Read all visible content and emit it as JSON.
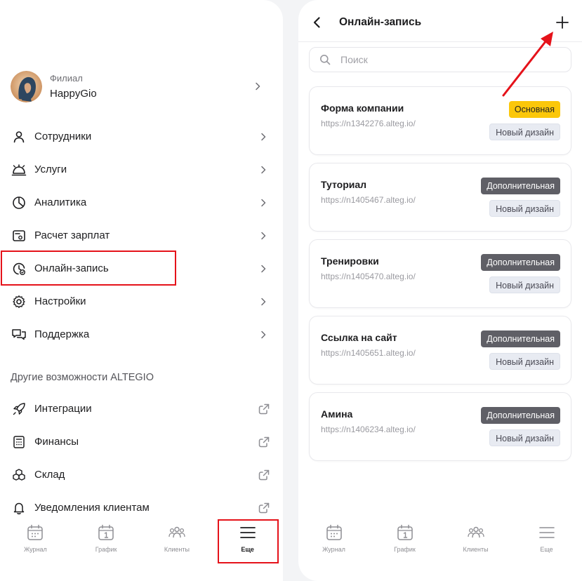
{
  "left": {
    "branch": {
      "caption": "Филиал",
      "name": "HappyGio"
    },
    "menu": [
      {
        "label": "Сотрудники",
        "icon": "person-icon"
      },
      {
        "label": "Услуги",
        "icon": "cloche-icon"
      },
      {
        "label": "Аналитика",
        "icon": "pie-chart-icon"
      },
      {
        "label": "Расчет зарплат",
        "icon": "payroll-icon"
      },
      {
        "label": "Онлайн-запись",
        "icon": "online-booking-icon"
      },
      {
        "label": "Настройки",
        "icon": "gear-icon"
      },
      {
        "label": "Поддержка",
        "icon": "chat-icon"
      }
    ],
    "section_title": "Другие возможности ALTEGIO",
    "other": [
      {
        "label": "Интеграции",
        "icon": "rocket-icon"
      },
      {
        "label": "Финансы",
        "icon": "calculator-icon"
      },
      {
        "label": "Склад",
        "icon": "boxes-icon"
      },
      {
        "label": "Уведомления клиентам",
        "icon": "bell-icon"
      }
    ],
    "tabbar": [
      {
        "label": "Журнал",
        "icon": "calendar-grid-icon"
      },
      {
        "label": "График",
        "icon": "calendar-day-icon"
      },
      {
        "label": "Клиенты",
        "icon": "clients-icon"
      },
      {
        "label": "Еще",
        "icon": "hamburger-icon"
      }
    ]
  },
  "right": {
    "title": "Онлайн-запись",
    "search_placeholder": "Поиск",
    "cards": [
      {
        "title": "Форма компании",
        "url": "https://n1342276.alteg.io/",
        "badge": "Основная",
        "badge_type": "main",
        "design": "Новый дизайн"
      },
      {
        "title": "Туториал",
        "url": "https://n1405467.alteg.io/",
        "badge": "Дополнительная",
        "badge_type": "extra",
        "design": "Новый дизайн"
      },
      {
        "title": "Тренировки",
        "url": "https://n1405470.alteg.io/",
        "badge": "Дополнительная",
        "badge_type": "extra",
        "design": "Новый дизайн"
      },
      {
        "title": "Ссылка на сайт",
        "url": "https://n1405651.alteg.io/",
        "badge": "Дополнительная",
        "badge_type": "extra",
        "design": "Новый дизайн"
      },
      {
        "title": "Амина",
        "url": "https://n1406234.alteg.io/",
        "badge": "Дополнительная",
        "badge_type": "extra",
        "design": "Новый дизайн"
      }
    ],
    "tabbar": [
      {
        "label": "Журнал",
        "icon": "calendar-grid-icon"
      },
      {
        "label": "График",
        "icon": "calendar-day-icon"
      },
      {
        "label": "Клиенты",
        "icon": "clients-icon"
      },
      {
        "label": "Еще",
        "icon": "hamburger-icon"
      }
    ]
  },
  "colors": {
    "highlight": "#e5121a",
    "badge_main": "#fbc70a",
    "badge_extra": "#5f5f66"
  }
}
